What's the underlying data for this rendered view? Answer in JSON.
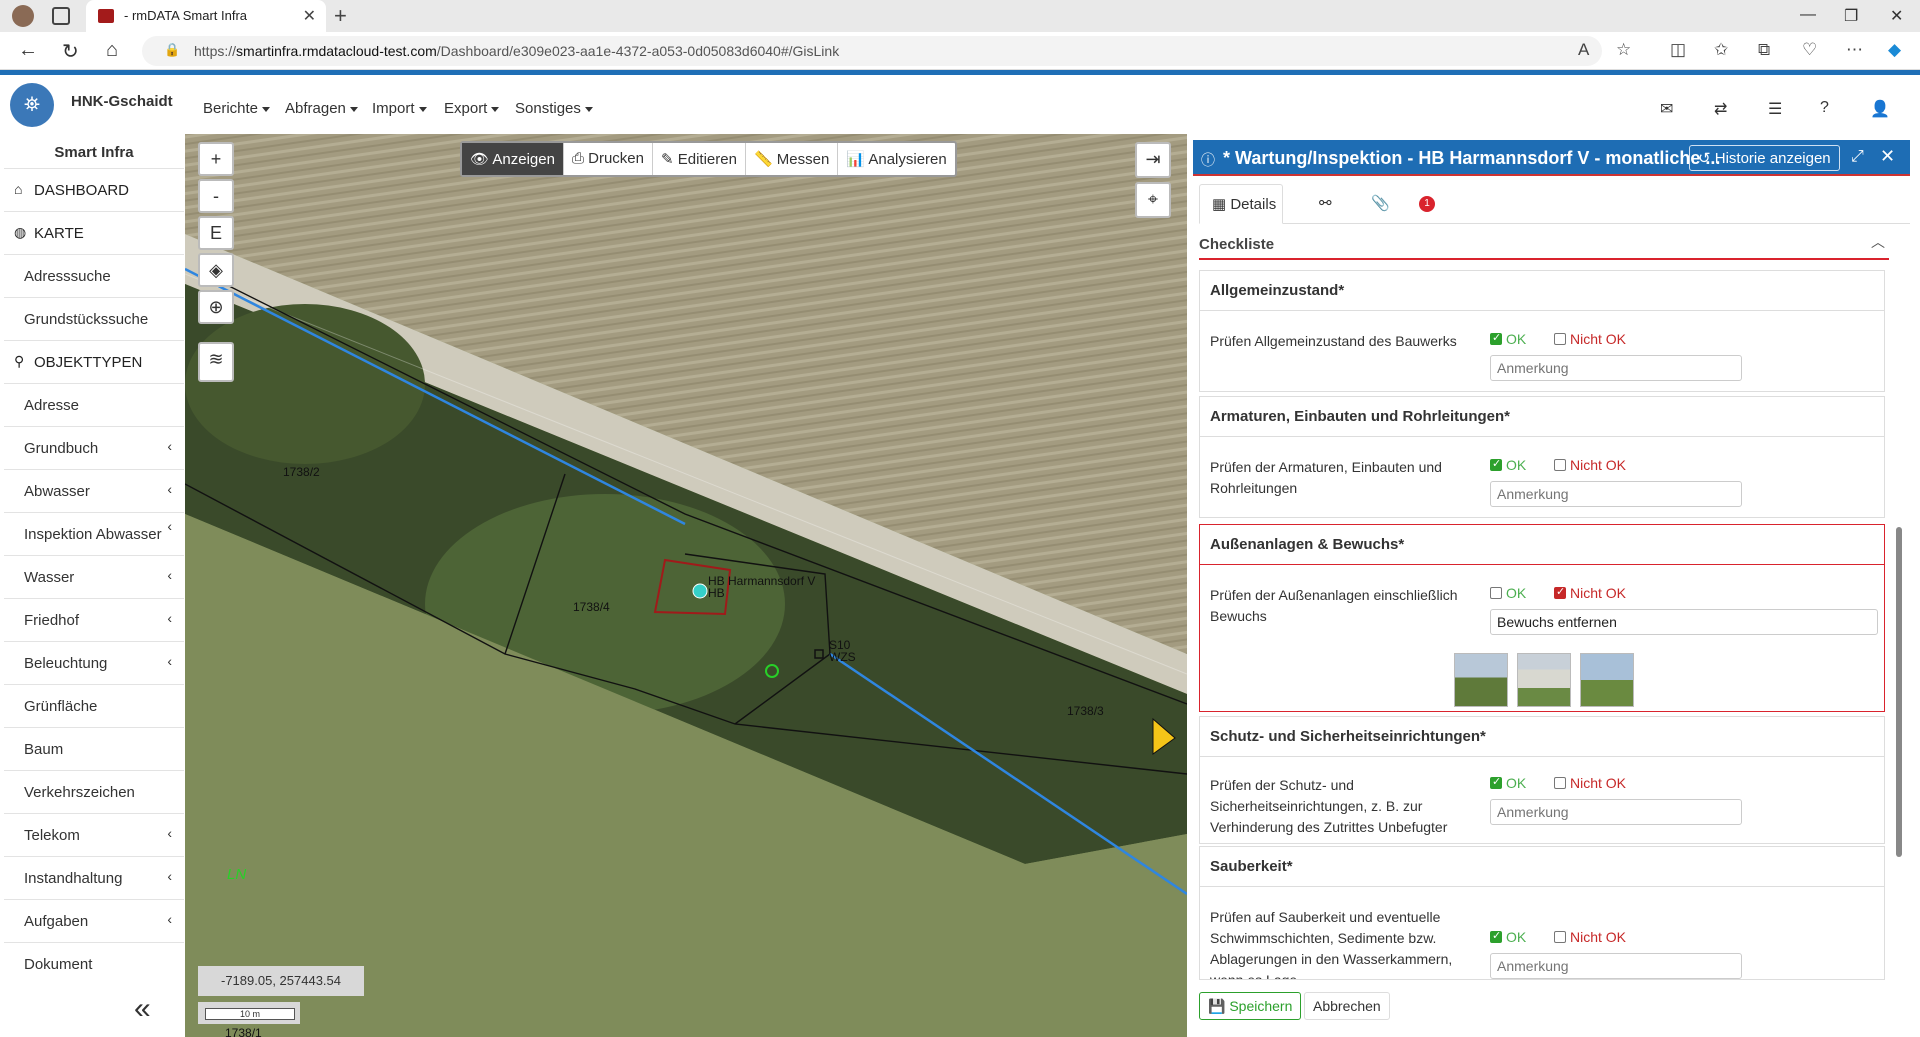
{
  "browser": {
    "tab_title": "- rmDATA Smart Infra",
    "url_prefix": "https://",
    "url_host": "smartinfra.rmdatacloud-test.com",
    "url_path": "/Dashboard/e309e023-aa1e-4372-a053-0d05083d6040#/GisLink"
  },
  "app": {
    "brand": "HNK-Gschaidt",
    "menu": [
      "Berichte",
      "Abfragen",
      "Import",
      "Export",
      "Sonstiges"
    ]
  },
  "sidebar": {
    "title": "Smart Infra",
    "dashboard": "DASHBOARD",
    "karte": "KARTE",
    "karte_items": [
      "Adresssuche",
      "Grundstückssuche"
    ],
    "objekttypen": "OBJEKTTYPEN",
    "items": [
      {
        "label": "Adresse",
        "chevron": false
      },
      {
        "label": "Grundbuch",
        "chevron": true
      },
      {
        "label": "Abwasser",
        "chevron": true
      },
      {
        "label": "Inspektion Abwasser",
        "chevron": true
      },
      {
        "label": "Wasser",
        "chevron": true
      },
      {
        "label": "Friedhof",
        "chevron": true
      },
      {
        "label": "Beleuchtung",
        "chevron": true
      },
      {
        "label": "Grünfläche",
        "chevron": false
      },
      {
        "label": "Baum",
        "chevron": false
      },
      {
        "label": "Verkehrszeichen",
        "chevron": false
      },
      {
        "label": "Telekom",
        "chevron": true
      },
      {
        "label": "Instandhaltung",
        "chevron": true
      },
      {
        "label": "Aufgaben",
        "chevron": true
      },
      {
        "label": "Dokument",
        "chevron": false
      }
    ]
  },
  "map": {
    "zoom_in": "+",
    "zoom_out": "-",
    "e_button": "E",
    "tools": [
      "Anzeigen",
      "Drucken",
      "Editieren",
      "Messen",
      "Analysieren"
    ],
    "parcel_labels": [
      "1738/2",
      "1738/4",
      "1738/3",
      "1738/1"
    ],
    "object_label_1": "HB Harmannsdorf V",
    "object_label_2": "HB",
    "s10_label": "S10",
    "wzs_label": "WZS",
    "ln_label": "LN",
    "coords": "-7189.05, 257443.54",
    "scale": "10 m"
  },
  "panel": {
    "title": "* Wartung/Inspektion - HB Harmannsdorf V - monatliche ...",
    "history_button": "Historie anzeigen",
    "tab_details": "Details",
    "badge_count": "1",
    "section_title": "Checkliste",
    "ok_label": "OK",
    "nok_label": "Nicht OK",
    "note_placeholder": "Anmerkung",
    "sections": [
      {
        "title": "Allgemeinzustand*",
        "question": "Prüfen Allgemeinzustand des Bauwerks",
        "note": "",
        "state": "ok"
      },
      {
        "title": "Armaturen, Einbauten und Rohrleitungen*",
        "question": "Prüfen der Armaturen, Einbauten und Rohrleitungen",
        "note": "",
        "state": "ok"
      },
      {
        "title": "Außenanlagen & Bewuchs*",
        "question": "Prüfen der Außenanlagen einschließlich Bewuchs",
        "note": "Bewuchs entfernen",
        "state": "nok"
      },
      {
        "title": "Schutz- und Sicherheitseinrichtungen*",
        "question": "Prüfen der Schutz- und Sicherheitseinrichtungen, z. B. zur Verhinderung des Zutrittes Unbefugter",
        "note": "",
        "state": "ok"
      },
      {
        "title": "Sauberkeit*",
        "question": "Prüfen auf Sauberkeit und eventuelle Schwimmschichten, Sedimente bzw. Ablagerungen in den Wasserkammern, wenn es Lage,",
        "note": "",
        "state": "ok"
      }
    ],
    "save_button": "Speichern",
    "cancel_button": "Abbrechen"
  }
}
